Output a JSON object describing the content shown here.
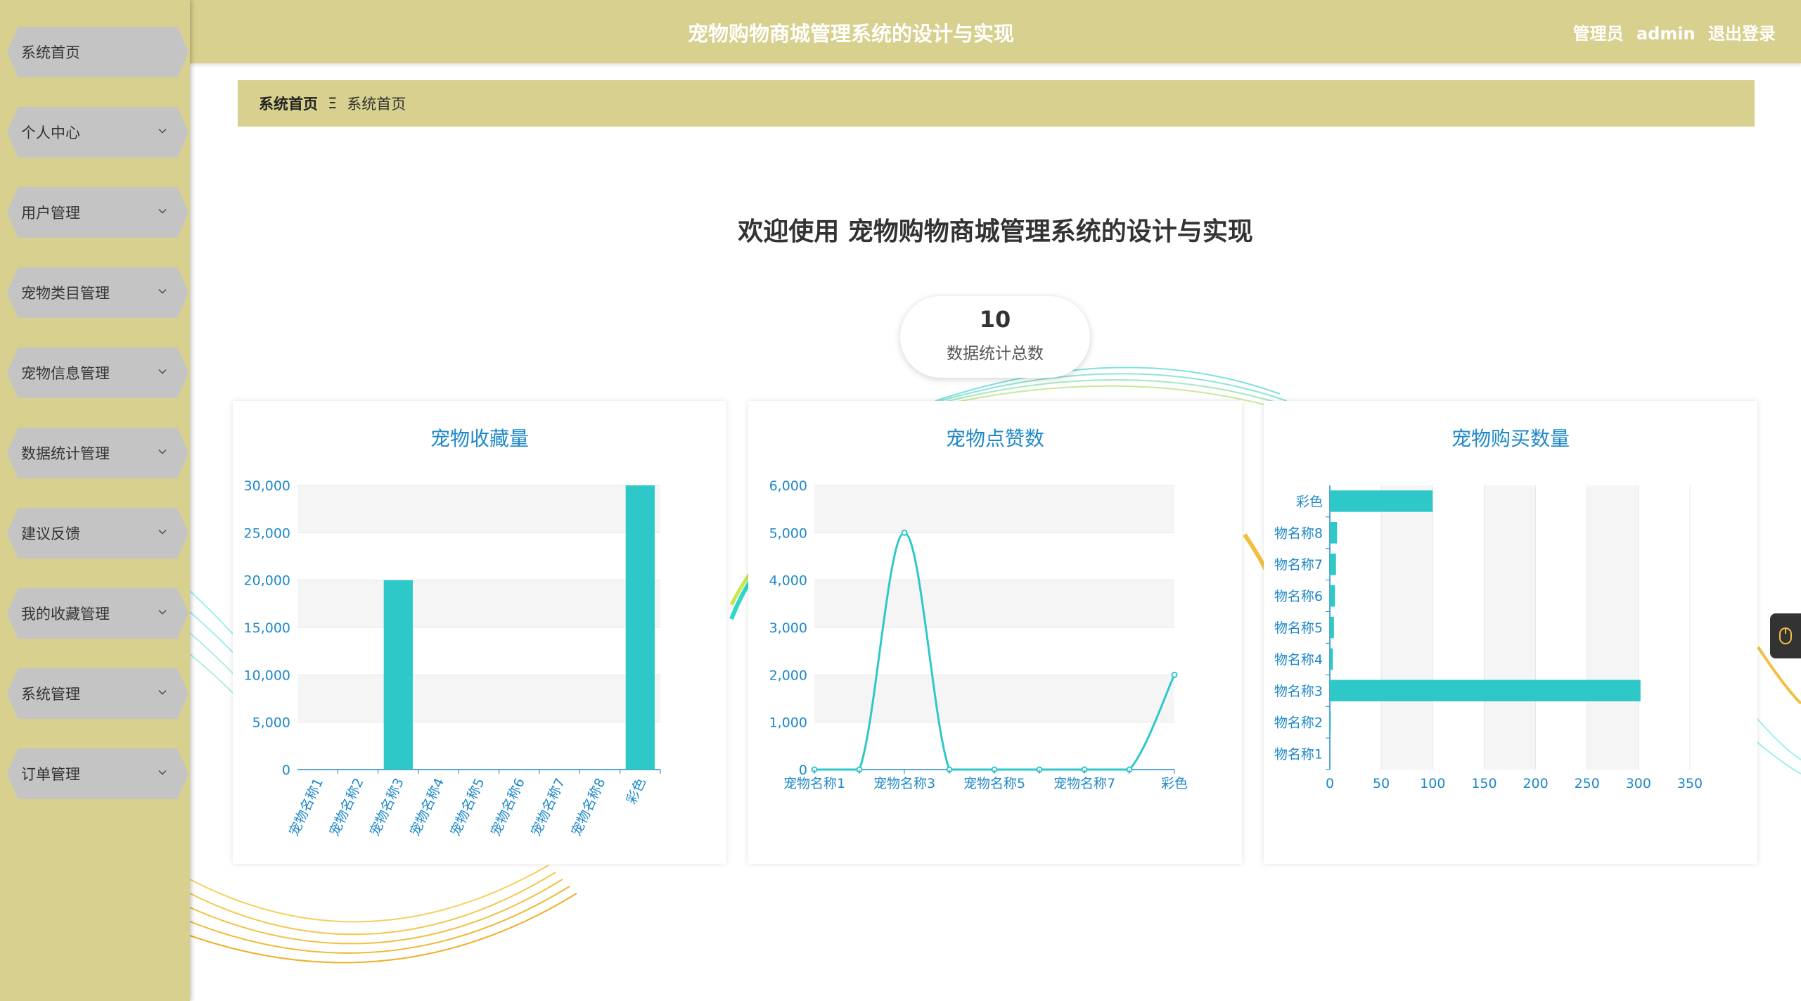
{
  "header": {
    "title": "宠物购物商城管理系统的设计与实现",
    "role": "管理员",
    "username": "admin",
    "logout_label": "退出登录"
  },
  "sidebar": {
    "items": [
      {
        "label": "系统首页",
        "expandable": false
      },
      {
        "label": "个人中心",
        "expandable": true
      },
      {
        "label": "用户管理",
        "expandable": true
      },
      {
        "label": "宠物类目管理",
        "expandable": true
      },
      {
        "label": "宠物信息管理",
        "expandable": true
      },
      {
        "label": "数据统计管理",
        "expandable": true
      },
      {
        "label": "建议反馈",
        "expandable": true
      },
      {
        "label": "我的收藏管理",
        "expandable": true
      },
      {
        "label": "系统管理",
        "expandable": true
      },
      {
        "label": "订单管理",
        "expandable": true
      }
    ]
  },
  "breadcrumb": {
    "home": "系统首页",
    "separator": "Ξ",
    "current": "系统首页"
  },
  "welcome": "欢迎使用 宠物购物商城管理系统的设计与实现",
  "stat": {
    "value": "10",
    "caption": "数据统计总数"
  },
  "colors": {
    "accent": "#d8d08e",
    "menu_item": "#c4c4c4",
    "chart": "#2ec8c8",
    "chart_text": "#1e88c8"
  },
  "chart_data": [
    {
      "type": "bar",
      "title": "宠物收藏量",
      "categories": [
        "宠物名称1",
        "宠物名称2",
        "宠物名称3",
        "宠物名称4",
        "宠物名称5",
        "宠物名称6",
        "宠物名称7",
        "宠物名称8",
        "彩色"
      ],
      "values": [
        0,
        0,
        20000,
        0,
        0,
        0,
        0,
        0,
        30000
      ],
      "ylim": [
        0,
        30000
      ],
      "yticks": [
        "0",
        "5,000",
        "10,000",
        "15,000",
        "20,000",
        "25,000",
        "30,000"
      ],
      "grid": true
    },
    {
      "type": "line",
      "title": "宠物点赞数",
      "categories": [
        "宠物名称1",
        "宠物名称2",
        "宠物名称3",
        "宠物名称4",
        "宠物名称5",
        "宠物名称6",
        "宠物名称7",
        "宠物名称8",
        "彩色"
      ],
      "xtick_labels": [
        "宠物名称1",
        "宠物名称3",
        "宠物名称5",
        "宠物名称7",
        "彩色"
      ],
      "values": [
        0,
        0,
        5000,
        0,
        0,
        0,
        0,
        0,
        2000
      ],
      "ylim": [
        0,
        6000
      ],
      "yticks": [
        "0",
        "1,000",
        "2,000",
        "3,000",
        "4,000",
        "5,000",
        "6,000"
      ],
      "grid": true
    },
    {
      "type": "bar",
      "orientation": "horizontal",
      "title": "宠物购买数量",
      "categories": [
        "宠物名称1",
        "宠物名称2",
        "宠物名称3",
        "宠物名称4",
        "宠物名称5",
        "宠物名称6",
        "宠物名称7",
        "宠物名称8",
        "彩色"
      ],
      "category_labels": [
        "物名称1",
        "物名称2",
        "物名称3",
        "物名称4",
        "物名称5",
        "物名称6",
        "物名称7",
        "物名称8",
        "彩色"
      ],
      "values": [
        0,
        1,
        302,
        3,
        4,
        5,
        6,
        7,
        100
      ],
      "xlim": [
        0,
        350
      ],
      "xticks": [
        "0",
        "50",
        "100",
        "150",
        "200",
        "250",
        "300",
        "350"
      ],
      "grid": true
    }
  ]
}
